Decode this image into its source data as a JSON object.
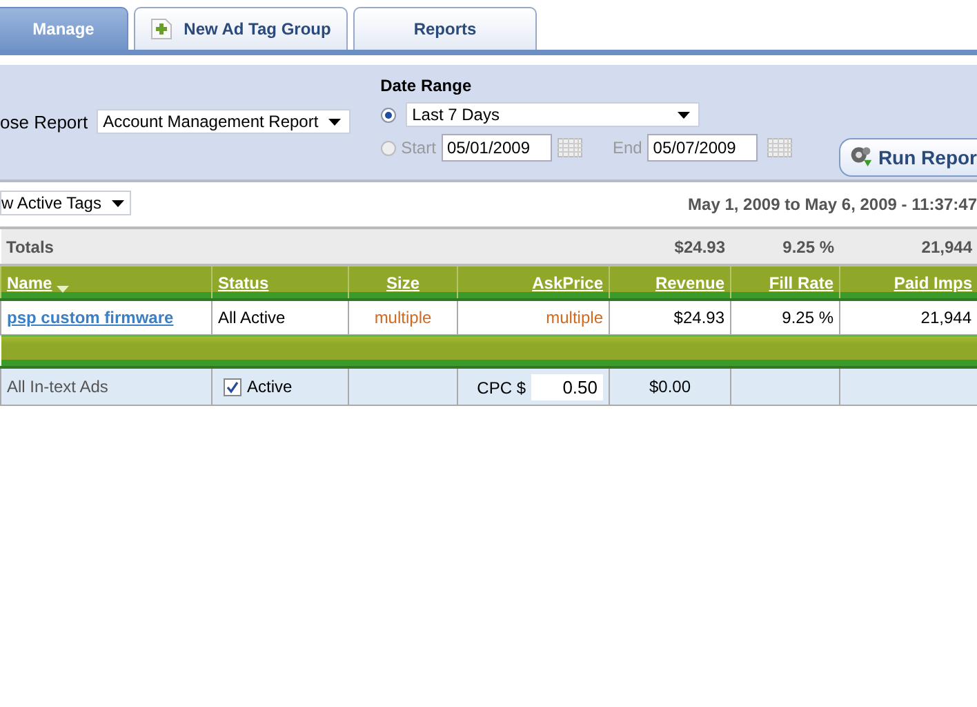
{
  "tabs": [
    {
      "label": "Manage",
      "selected": true,
      "kind": "plain"
    },
    {
      "label": "New Ad Tag Group",
      "selected": false,
      "kind": "add"
    },
    {
      "label": "Reports",
      "selected": false,
      "kind": "plain"
    }
  ],
  "panel": {
    "report_label": "ose Report",
    "report_select": "Account Management Report",
    "date_range_label": "Date Range",
    "preset": {
      "selected": true,
      "value": "Last 7 Days"
    },
    "custom": {
      "selected": false,
      "start_label": "Start",
      "start": "05/01/2009",
      "end_label": "End",
      "end": "05/07/2009"
    },
    "run_button": "Run Repor"
  },
  "filter": {
    "value": "w Active Tags"
  },
  "range_text": "May 1, 2009 to May 6, 2009 - 11:37:47",
  "totals": {
    "label": "Totals",
    "revenue": "$24.93",
    "fill_rate": "9.25 %",
    "paid_imps": "21,944"
  },
  "columns": [
    {
      "label": "Name",
      "sorted": true
    },
    {
      "label": "Status",
      "sorted": false
    },
    {
      "label": "Size",
      "sorted": false
    },
    {
      "label": "AskPrice",
      "sorted": false
    },
    {
      "label": "Revenue",
      "sorted": false
    },
    {
      "label": "Fill Rate",
      "sorted": false
    },
    {
      "label": "Paid Imps",
      "sorted": false
    }
  ],
  "rows": [
    {
      "name": "psp custom firmware",
      "status": "All Active",
      "size": "multiple",
      "ask_price": "multiple",
      "revenue": "$24.93",
      "fill_rate": "9.25 %",
      "paid_imps": "21,944"
    }
  ],
  "intext": {
    "name": "All In-text Ads",
    "active": true,
    "active_label": "Active",
    "cpc_label": "CPC $",
    "cpc": "0.50",
    "revenue": "$0.00"
  }
}
